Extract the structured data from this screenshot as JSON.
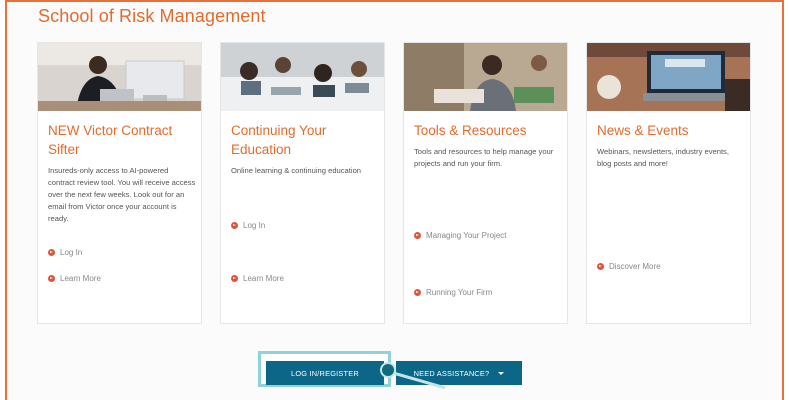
{
  "section": {
    "title": "School of Risk Management"
  },
  "cards": [
    {
      "title": "NEW Victor Contract Sifter",
      "description": "Insureds-only access to AI-powered contract review tool. You will receive access over the next few weeks. Look out for an email from Victor once your account is ready.",
      "links": [
        "Log In",
        "Learn More"
      ]
    },
    {
      "title": "Continuing Your Education",
      "description": "Online learning & continuing education",
      "links": [
        "Log In",
        "Learn More"
      ]
    },
    {
      "title": "Tools & Resources",
      "description": "Tools and resources to help manage your projects and run your firm.",
      "links": [
        "Managing Your Project",
        "Running Your Firm"
      ]
    },
    {
      "title": "News & Events",
      "description": "Webinars, newsletters, industry events, blog posts and more!",
      "links": [
        "Discover More"
      ]
    }
  ],
  "buttons": {
    "login_register": "LOG IN/REGISTER",
    "need_assistance": "NEED ASSISTANCE?"
  },
  "colors": {
    "accent": "#e36b2c",
    "button": "#0c6687",
    "highlight": "#8fd3d6"
  }
}
